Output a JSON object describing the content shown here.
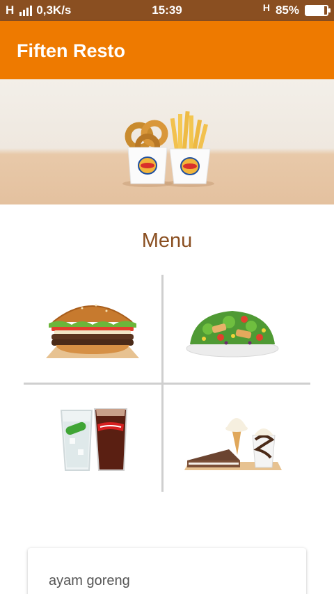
{
  "status_bar": {
    "network_label": "H",
    "speed": "0,3K/s",
    "time": "15:39",
    "network_type": "H",
    "battery_percent_text": "85%",
    "battery_level": 0.85
  },
  "app_bar": {
    "title": "Fiften Resto"
  },
  "menu": {
    "title": "Menu",
    "items": [
      {
        "icon": "burger-icon"
      },
      {
        "icon": "salad-icon"
      },
      {
        "icon": "drinks-icon"
      },
      {
        "icon": "dessert-icon"
      }
    ]
  },
  "card": {
    "text": "ayam goreng"
  },
  "colors": {
    "app_bar": "#ee7a00",
    "status_bar": "#8a4f21",
    "menu_title": "#8a4f21"
  }
}
